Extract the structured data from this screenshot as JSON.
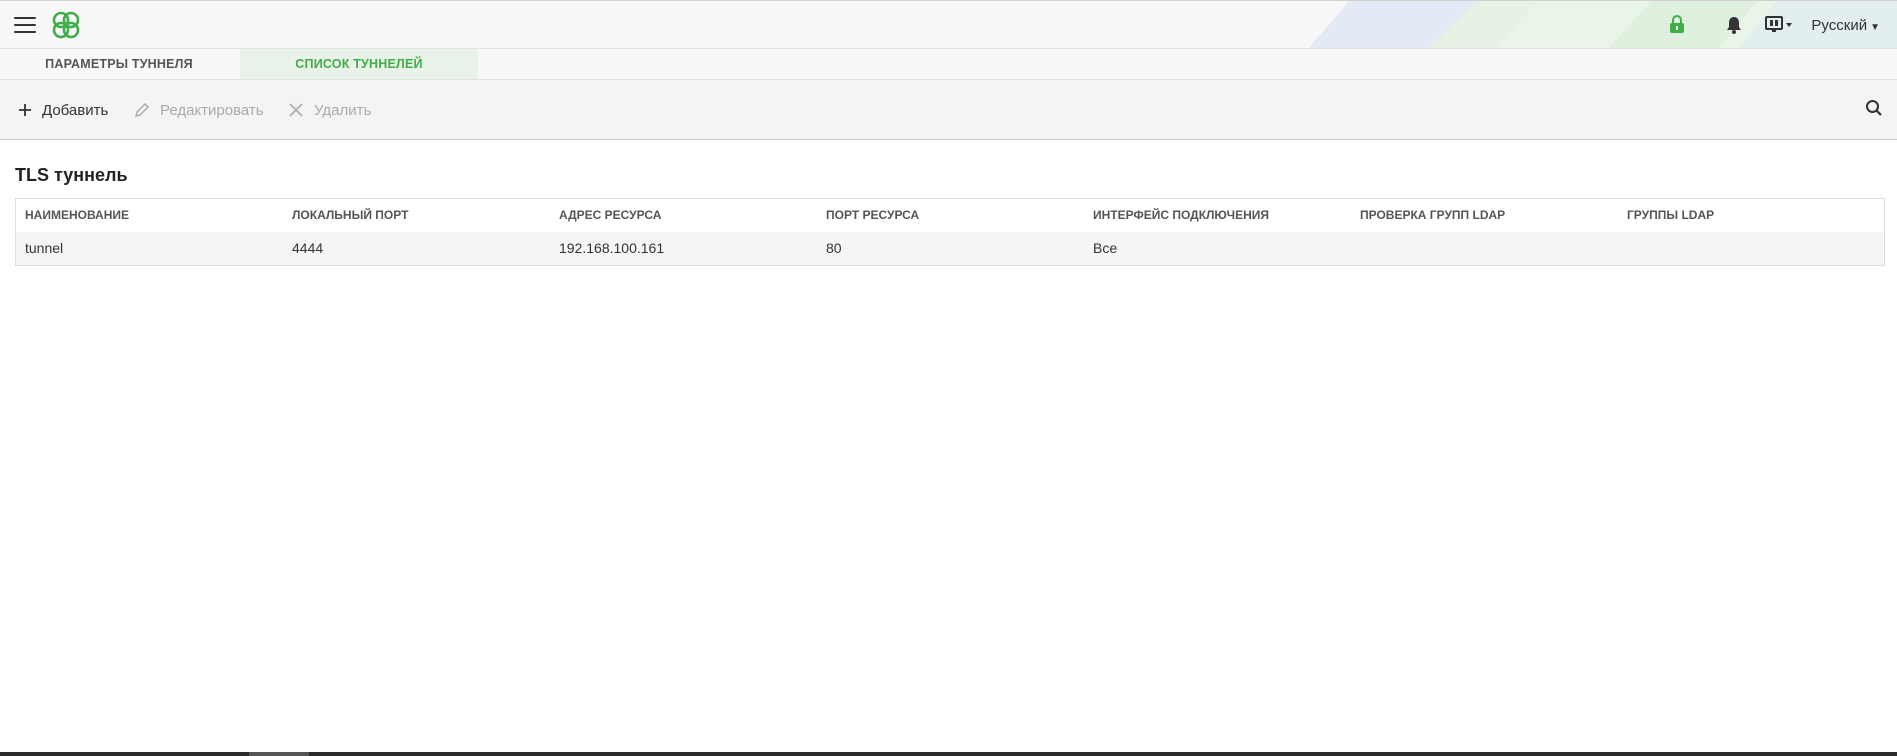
{
  "header": {
    "language": "Русский",
    "brand_color": "#3fae49",
    "icons": [
      "menu-icon",
      "logo-icon",
      "lock-icon",
      "bell-icon",
      "monitor-icon"
    ]
  },
  "tabs": [
    {
      "label": "ПАРАМЕТРЫ ТУННЕЛЯ",
      "active": false
    },
    {
      "label": "СПИСОК ТУННЕЛЕЙ",
      "active": true
    }
  ],
  "toolbar": {
    "add_label": "Добавить",
    "edit_label": "Редактировать",
    "delete_label": "Удалить"
  },
  "section": {
    "title": "TLS туннель"
  },
  "table": {
    "columns": [
      "НАИМЕНОВАНИЕ",
      "ЛОКАЛЬНЫЙ ПОРТ",
      "АДРЕС РЕСУРСА",
      "ПОРТ РЕСУРСА",
      "ИНТЕРФЕЙС ПОДКЛЮЧЕНИЯ",
      "ПРОВЕРКА ГРУПП LDAP",
      "ГРУППЫ LDAP"
    ],
    "rows": [
      [
        "tunnel",
        "4444",
        "192.168.100.161",
        "80",
        "Все",
        "",
        ""
      ]
    ]
  }
}
